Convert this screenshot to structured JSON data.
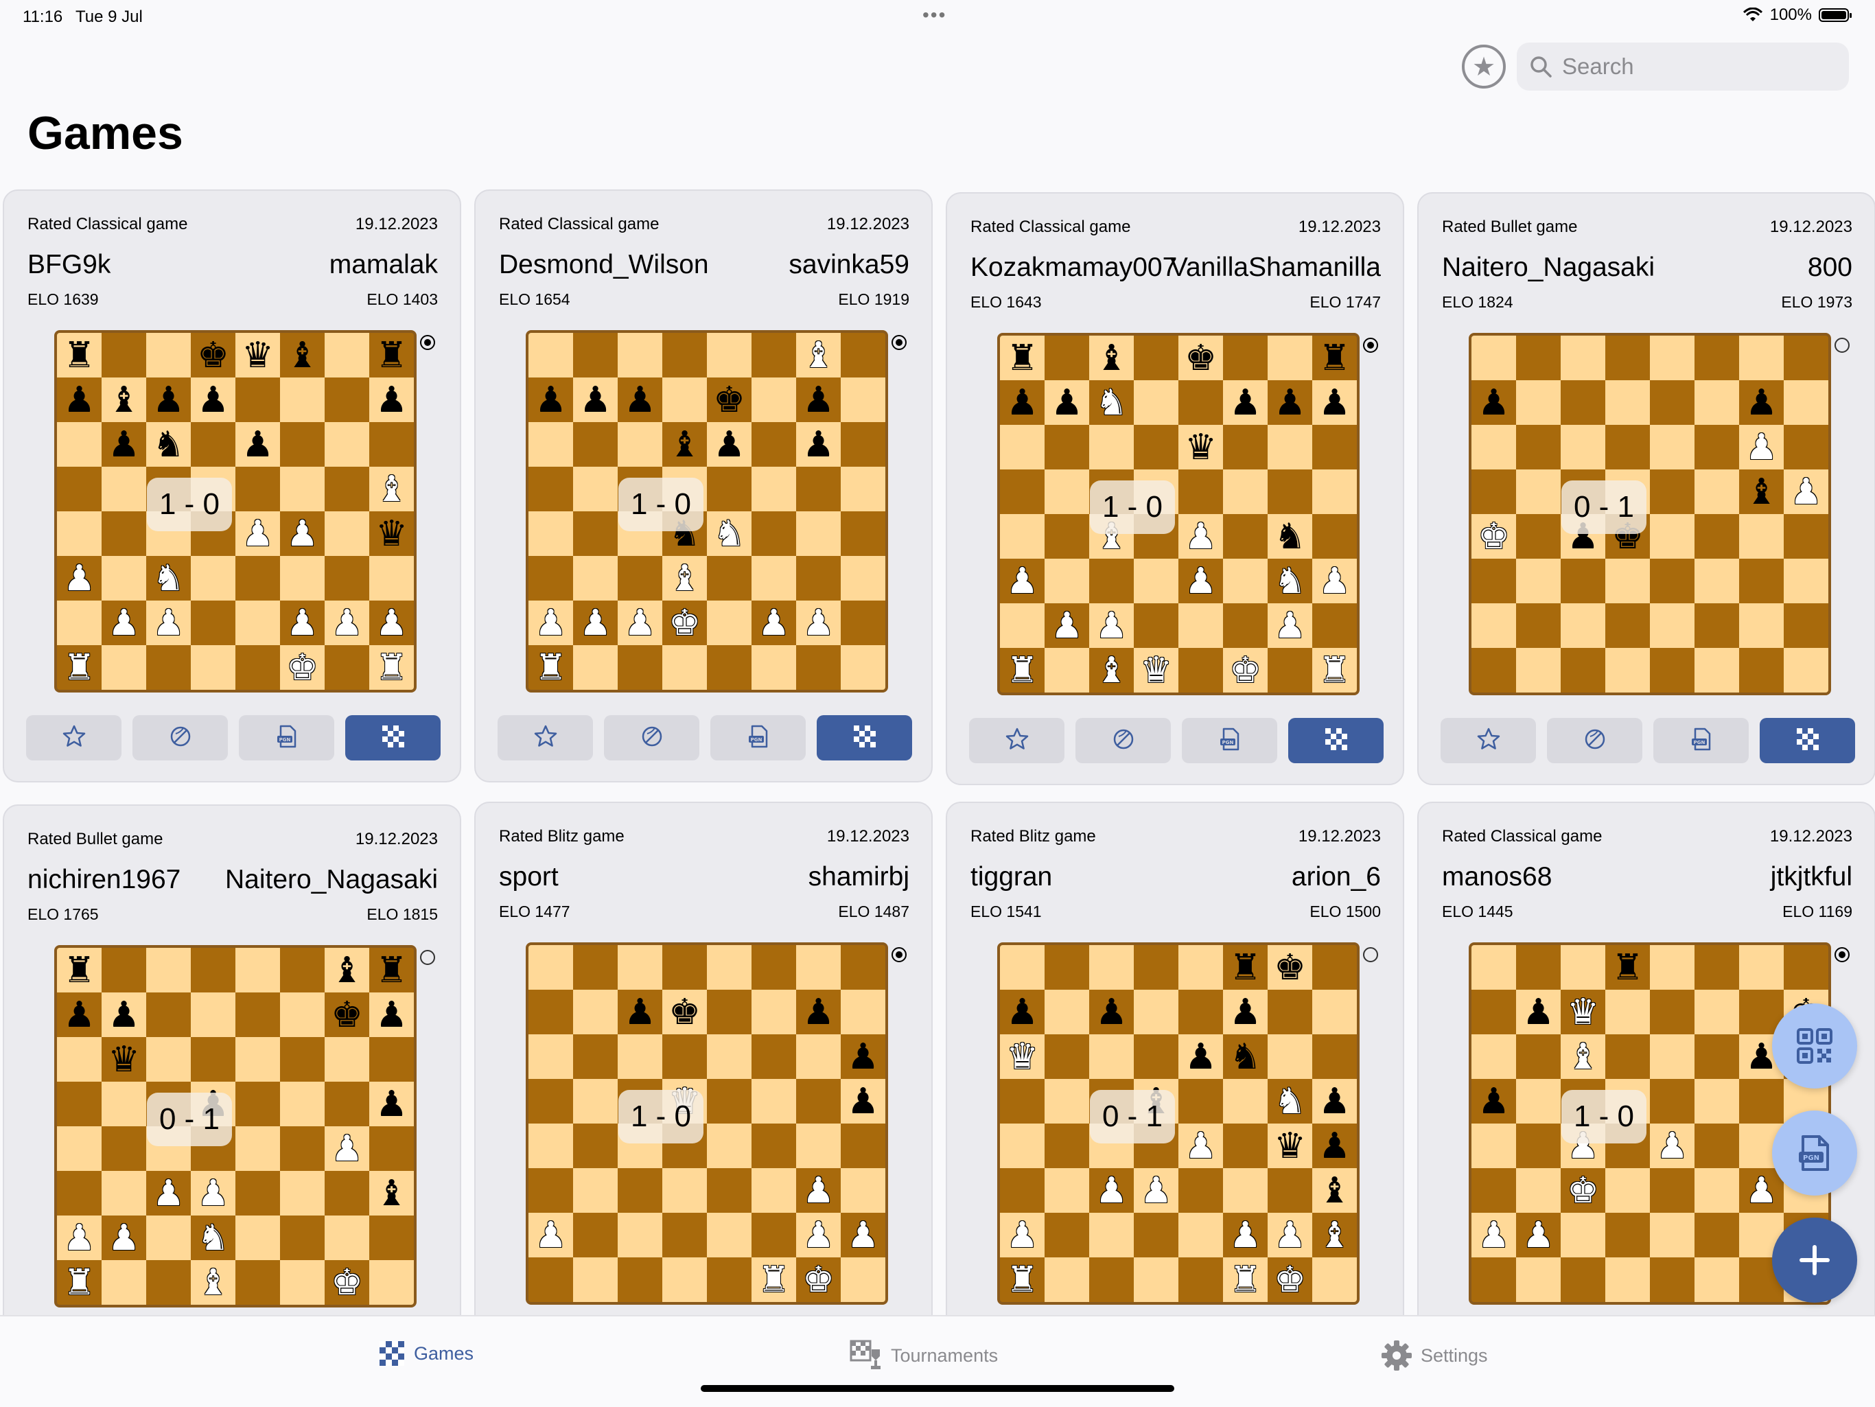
{
  "status_bar": {
    "time": "11:16",
    "date": "Tue 9 Jul",
    "battery": "100%"
  },
  "search": {
    "placeholder": "Search"
  },
  "page": {
    "title": "Games"
  },
  "games": [
    {
      "type": "Rated Classical game",
      "date": "19.12.2023",
      "white": "BFG9k",
      "black": "mamalak",
      "white_elo": "ELO 1639",
      "black_elo": "ELO 1403",
      "result": "1 - 0",
      "turn": "black",
      "board": [
        "r..kqb.r",
        "pbpp...p",
        ".pn.p...",
        ".......B",
        "....PP.q",
        "P.N.....",
        ".PP..PPP",
        "R....K.R"
      ]
    },
    {
      "type": "Rated Classical game",
      "date": "19.12.2023",
      "white": "Desmond_Wilson",
      "black": "savinka59",
      "white_elo": "ELO 1654",
      "black_elo": "ELO 1919",
      "result": "1 - 0",
      "turn": "black",
      "board": [
        "......B.",
        "ppp.k.p.",
        "...bp.p.",
        "........",
        "...nN...",
        "...B....",
        "PPPK.PP.",
        "R......."
      ]
    },
    {
      "type": "Rated Classical game",
      "date": "19.12.2023",
      "white": "Kozakmamay007",
      "black": "VanillaShamanilla",
      "white_elo": "ELO 1643",
      "black_elo": "ELO 1747",
      "result": "1 - 0",
      "turn": "black",
      "board": [
        "r.b.k..r",
        "ppN..ppp",
        "....q...",
        "........",
        "..B.P.n.",
        "P...P.NP",
        ".PP...P.",
        "R.BQ.K.R"
      ]
    },
    {
      "type": "Rated Bullet game",
      "date": "19.12.2023",
      "white": "Naitero_Nagasaki",
      "black": "800",
      "white_elo": "ELO 1824",
      "black_elo": "ELO 1973",
      "result": "0 - 1",
      "turn": "white",
      "board": [
        "........",
        "p.....p.",
        "......P.",
        "......bP",
        "K.pk....",
        "........",
        "........",
        "........"
      ]
    },
    {
      "type": "Rated Bullet game",
      "date": "19.12.2023",
      "white": "nichiren1967",
      "black": "Naitero_Nagasaki",
      "white_elo": "ELO 1765",
      "black_elo": "ELO 1815",
      "result": "0 - 1",
      "turn": "white",
      "board": [
        "r.....br",
        "pp....kp",
        ".q......",
        "...p...p",
        "......P.",
        "..PP...b",
        "PP.N....",
        "R..B..K."
      ]
    },
    {
      "type": "Rated Blitz game",
      "date": "19.12.2023",
      "white": "sport",
      "black": "shamirbj",
      "white_elo": "ELO 1477",
      "black_elo": "ELO 1487",
      "result": "1 - 0",
      "turn": "black",
      "board": [
        "........",
        "..pk..p.",
        ".......p",
        "...Q...p",
        "........",
        "......P.",
        "P.....PP",
        ".....RK."
      ]
    },
    {
      "type": "Rated Blitz game",
      "date": "19.12.2023",
      "white": "tiggran",
      "black": "arion_6",
      "white_elo": "ELO 1541",
      "black_elo": "ELO 1500",
      "result": "0 - 1",
      "turn": "white",
      "board": [
        ".....rk.",
        "p.p..p..",
        "Q...pn..",
        "...b..Np",
        "....P.qp",
        "..PP...b",
        "P....PPB",
        "R....RK."
      ]
    },
    {
      "type": "Rated Classical game",
      "date": "19.12.2023",
      "white": "manos68",
      "black": "jtkjtkful",
      "white_elo": "ELO 1445",
      "black_elo": "ELO 1169",
      "result": "1 - 0",
      "turn": "black",
      "board": [
        "...r....",
        ".pQ....k",
        "..B...pp",
        "p.......",
        "..P.P...",
        "..K...P.",
        "PP......",
        "........"
      ]
    }
  ],
  "tabs": [
    {
      "label": "Games",
      "icon": "board-icon",
      "active": true
    },
    {
      "label": "Tournaments",
      "icon": "tournament-icon",
      "active": false
    },
    {
      "label": "Settings",
      "icon": "gear-icon",
      "active": false
    }
  ],
  "colors": {
    "accent": "#3e5e9f",
    "light_square": "#ffd998",
    "dark_square": "#a86a0c",
    "fab_light": "#a9c4f5"
  }
}
